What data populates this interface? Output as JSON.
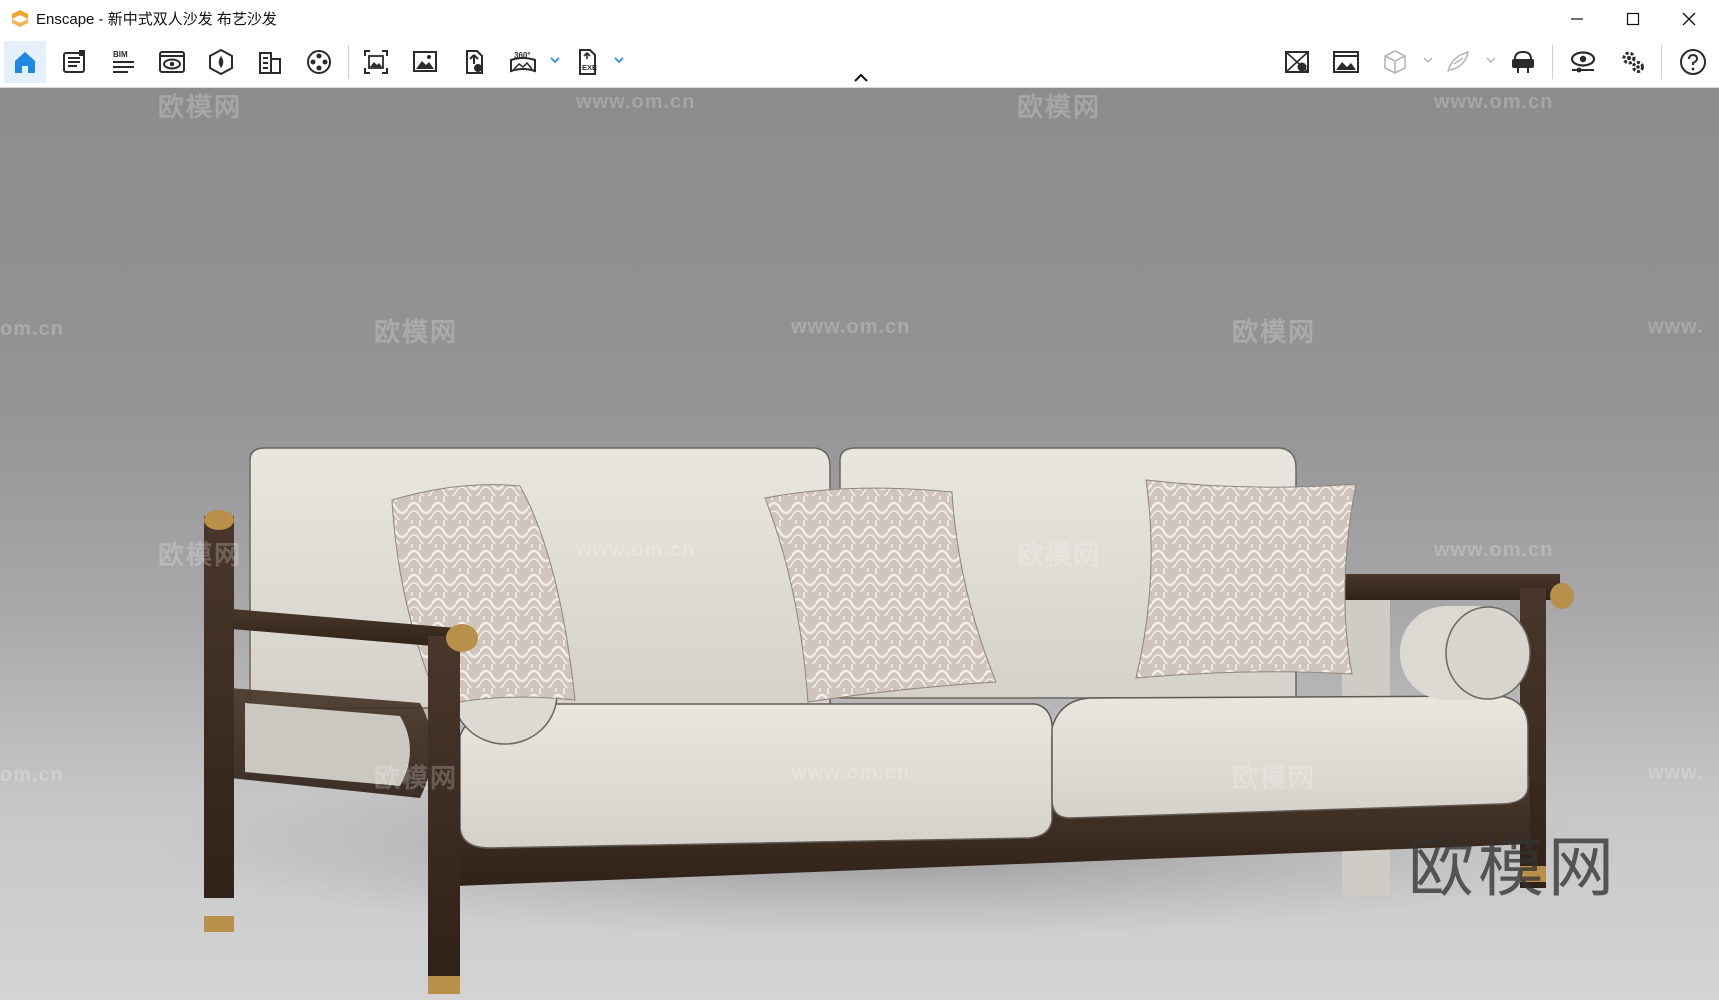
{
  "window": {
    "app_name": "Enscape",
    "title": "Enscape - 新中式双人沙发 布艺沙发",
    "controls": [
      "minimize",
      "maximize",
      "close"
    ]
  },
  "toolbar": {
    "left": [
      {
        "icon": "home-icon",
        "active": true
      },
      {
        "icon": "document-icon"
      },
      {
        "icon": "bim-icon",
        "label": "BIM"
      },
      {
        "icon": "view-window-icon"
      },
      {
        "icon": "asset-library-icon"
      },
      {
        "icon": "building-icon"
      },
      {
        "icon": "film-reel-icon"
      },
      {
        "icon": "screenshot-icon"
      },
      {
        "icon": "image-gallery-icon"
      },
      {
        "icon": "upload-file-icon"
      },
      {
        "icon": "panorama-360-icon",
        "label": "360°",
        "dropdown": true
      },
      {
        "icon": "export-exe-icon",
        "label": "EXE",
        "dropdown": true
      }
    ],
    "right": [
      {
        "icon": "map-view-icon"
      },
      {
        "icon": "image-settings-icon"
      },
      {
        "icon": "cube-icon",
        "dropdown": true,
        "disabled": true
      },
      {
        "icon": "feather-icon",
        "dropdown": true,
        "disabled": true
      },
      {
        "icon": "vr-headset-icon"
      },
      {
        "icon": "visual-settings-icon"
      },
      {
        "icon": "settings-gears-icon"
      },
      {
        "icon": "help-icon"
      }
    ]
  },
  "viewport": {
    "watermark_text": "欧模网",
    "watermark_url": "www.om.cn",
    "watermark_url_partial": "om.cn",
    "watermark_url_partial_right": "www.",
    "big_watermark": "欧模网"
  },
  "colors": {
    "accent": "#1e88e5",
    "logo": "#f4a32b",
    "icon": "#2b2b2b",
    "wood": "#3d2c22",
    "fabric": "#e4e1db",
    "brass": "#b9904a"
  }
}
